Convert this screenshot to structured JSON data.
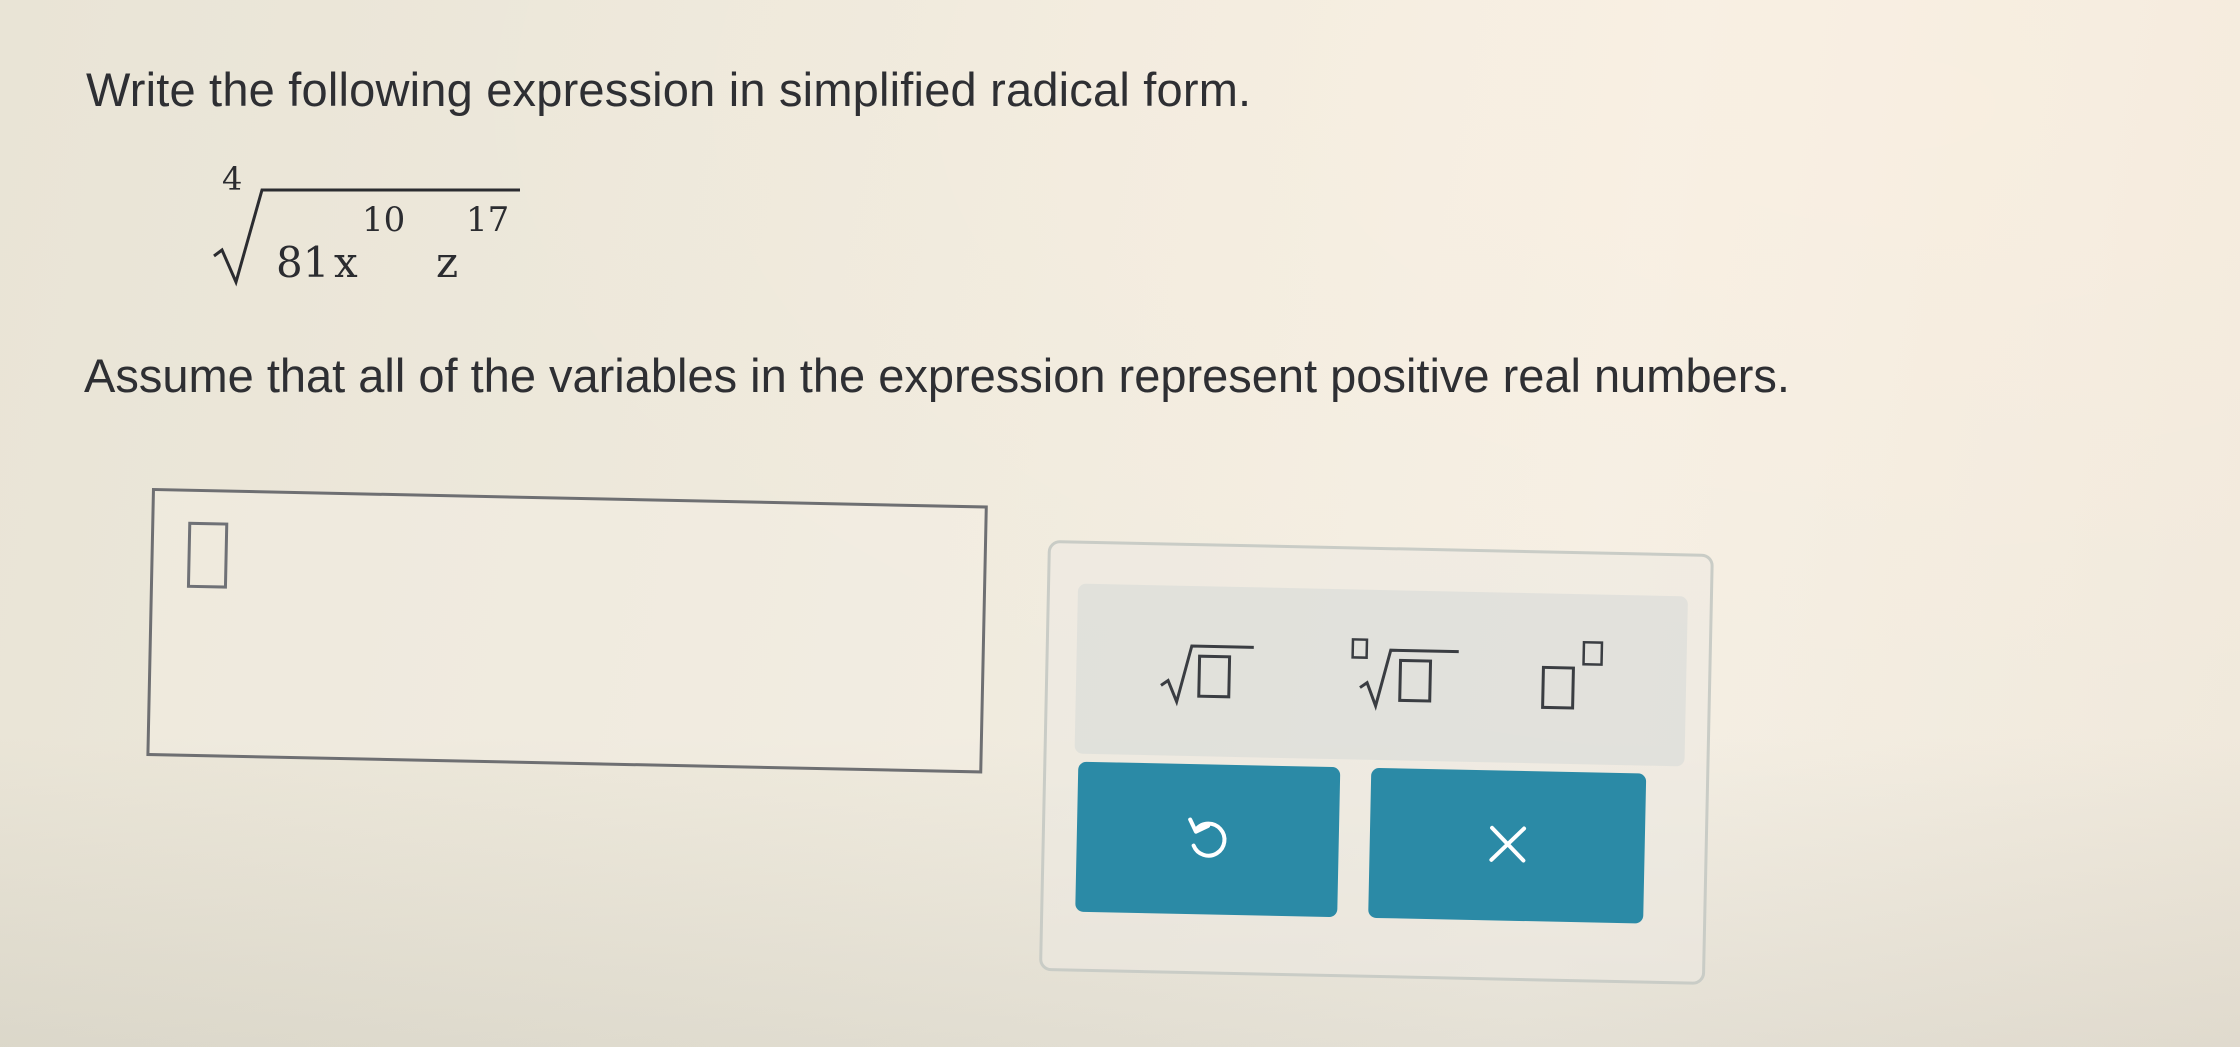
{
  "question": {
    "prompt": "Write the following expression in simplified radical form.",
    "expression": {
      "index": "4",
      "coefficient": "81",
      "var1": "x",
      "exp1": "10",
      "var2": "z",
      "exp2": "17"
    },
    "note": "Assume that all of the variables in the expression represent positive real numbers."
  },
  "answer": {
    "value": ""
  },
  "keypad": {
    "keys": [
      {
        "name": "square-root",
        "icon": "sqrt-template-icon"
      },
      {
        "name": "nth-root",
        "icon": "nth-root-template-icon"
      },
      {
        "name": "exponent",
        "icon": "superscript-template-icon"
      }
    ],
    "undo": {
      "icon": "undo-icon"
    },
    "clear": {
      "label": "×"
    }
  },
  "colors": {
    "button": "#2b8aa6",
    "text": "#2e2f33"
  }
}
